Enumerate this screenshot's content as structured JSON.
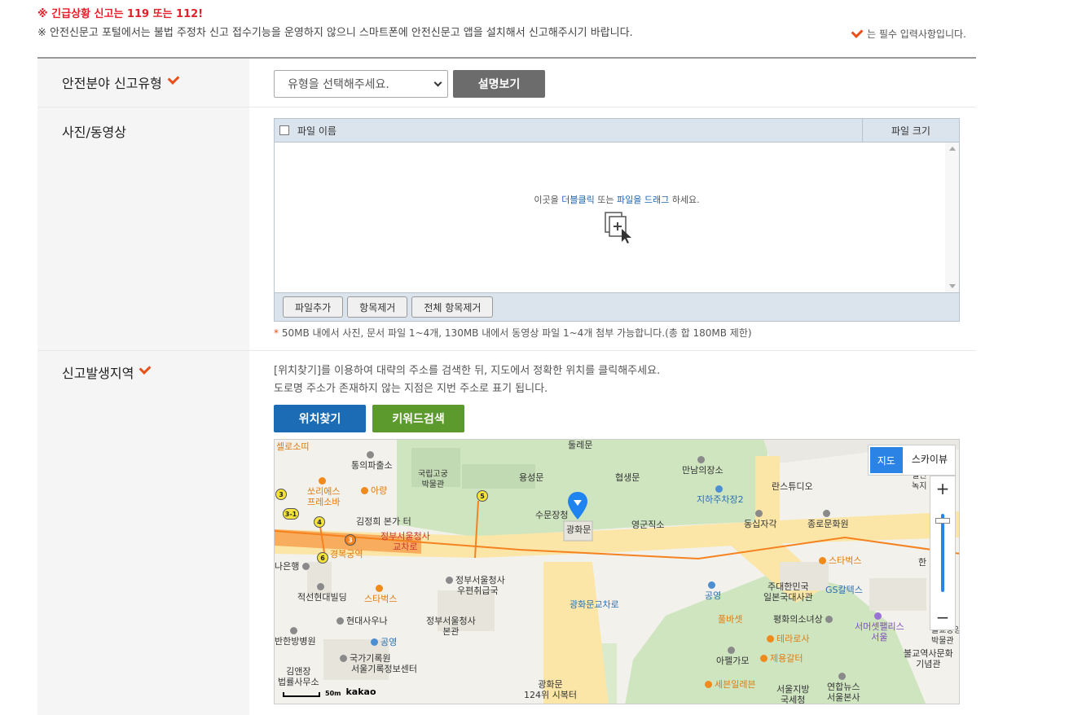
{
  "notices": {
    "emergency": "※ 긴급상황 신고는 119 또는 112!",
    "app_notice": "※ 안전신문고 포털에서는 불법 주정차 신고 접수기능을 운영하지 않으니 스마트폰에 안전신문고 앱을 설치해서 신고해주시기 바랍니다.",
    "required_note": "는 필수 입력사항입니다."
  },
  "report_type": {
    "label": "안전분야 신고유형",
    "select_value": "유형을 선택해주세요.",
    "describe_button": "설명보기"
  },
  "photo": {
    "label": "사진/동영상",
    "col_name": "파일 이름",
    "col_size": "파일 크기",
    "hint_prefix": "이곳을 ",
    "hint_dblclick": "더블클릭",
    "hint_mid": " 또는 ",
    "hint_drag": "파일을 드래그",
    "hint_suffix": " 하세요.",
    "add_button": "파일추가",
    "remove_button": "항목제거",
    "remove_all_button": "전체 항목제거",
    "note_star": "*",
    "note": "50MB 내에서 사진, 문서 파일 1~4개, 130MB 내에서 동영상 파일 1~4개 첨부 가능합니다.(총 합 180MB 제한)"
  },
  "location": {
    "label": "신고발생지역",
    "desc1": "[위치찾기]를 이용하여 대략의 주소를 검색한 뒤, 지도에서 정확한 위치를 클릭해주세요.",
    "desc2": "도로명 주소가 존재하지 않는 지점은 지번 주소로 표기 됩니다.",
    "find_button": "위치찾기",
    "keyword_button": "키워드검색"
  },
  "map": {
    "toggle_map": "지도",
    "toggle_sky": "스카이뷰",
    "zoom_in": "+",
    "zoom_out": "−",
    "scale": "50m",
    "brand": "kakao",
    "pois": {
      "p1": "셀로소띠",
      "p2": "통의파출소",
      "p3": "국립고궁",
      "p3b": "박물관",
      "p4": "용성문",
      "p5": "협생문",
      "p6": "만남의장소",
      "p7": "지하주차장2",
      "p8": "란스튜디오",
      "p9": "열린",
      "p9b": "녹지",
      "p10": "쏘리에스",
      "p10b": "프레소바",
      "p11": "아량",
      "p12": "김정희 본가 터",
      "p13": "수문장청",
      "p14": "광화문",
      "p15": "영군직소",
      "p16": "동십자각",
      "p17": "종로문화원",
      "p18": "정부서울청사",
      "p18b": "교차로",
      "p19": "경복궁역",
      "p20": "나은행",
      "p21": "스타벅스",
      "p22": "한",
      "p23": "정부서울청사",
      "p23b": "우편취급국",
      "p24": "주대한민국",
      "p24b": "일본국대사관",
      "p25": "GS칼텍스",
      "p26": "적선현대빌딩",
      "p27": "스타벅스",
      "p28": "공영",
      "p29": "광화문교차로",
      "p30": "현대사우나",
      "p31": "정부서울청사",
      "p31b": "본관",
      "p32": "풀바셋",
      "p33": "평화의소녀상",
      "p34": "서머셋팰리스",
      "p34b": "서울",
      "p35": "불교중앙",
      "p35b": "박물관",
      "p36": "반한방병원",
      "p37": "공영",
      "p38": "테라로사",
      "p39": "불교역사문화",
      "p39b": "기념관",
      "p40": "국가기록원",
      "p40b": "서울기록정보센터",
      "p41": "아펠가모",
      "p42": "제용갈터",
      "p43": "김앤장",
      "p43b": "법률사무소",
      "p44": "광화문",
      "p44b": "124위 시복터",
      "p45": "세븐일레븐",
      "p46": "서울지방",
      "p46b": "국세청",
      "p47": "연합뉴스",
      "p47b": "서울본사",
      "p48": "둘레문"
    }
  },
  "colors": {
    "emergency": "#e4202a",
    "required_check": "#e8501a",
    "find_button": "#1b6cb5",
    "keyword_button": "#5d9a2d",
    "describe_button": "#6c6c6c"
  }
}
